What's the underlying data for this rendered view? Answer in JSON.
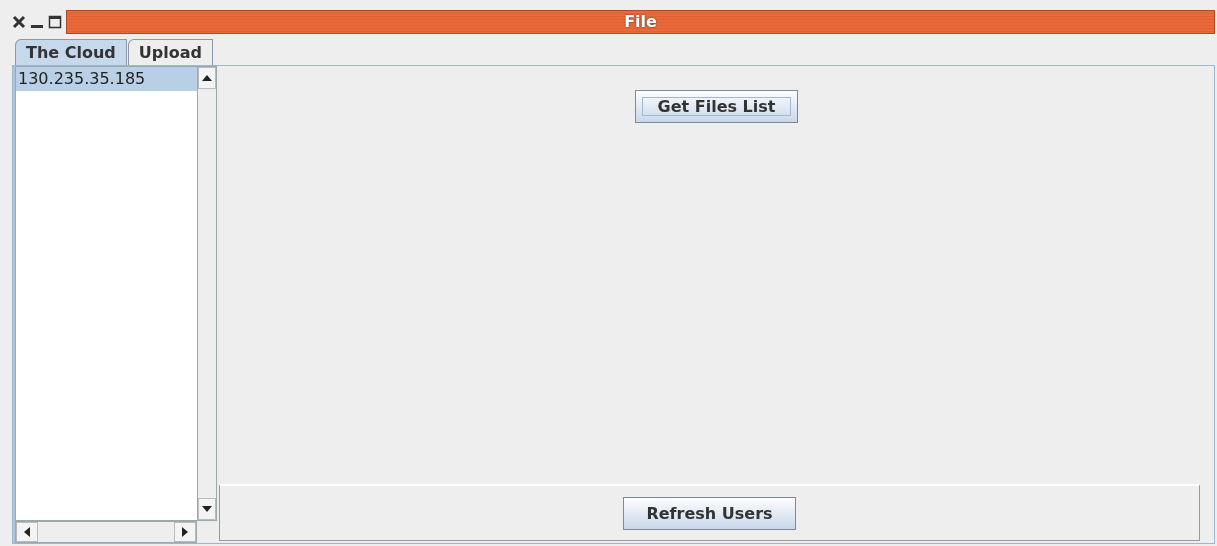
{
  "window": {
    "title": "File"
  },
  "tabs": [
    {
      "label": "The Cloud",
      "selected": true
    },
    {
      "label": "Upload",
      "selected": false
    }
  ],
  "users": {
    "items": [
      {
        "label": "130.235.35.185",
        "selected": true
      }
    ]
  },
  "buttons": {
    "get_files": "Get Files List",
    "refresh": "Refresh Users"
  }
}
